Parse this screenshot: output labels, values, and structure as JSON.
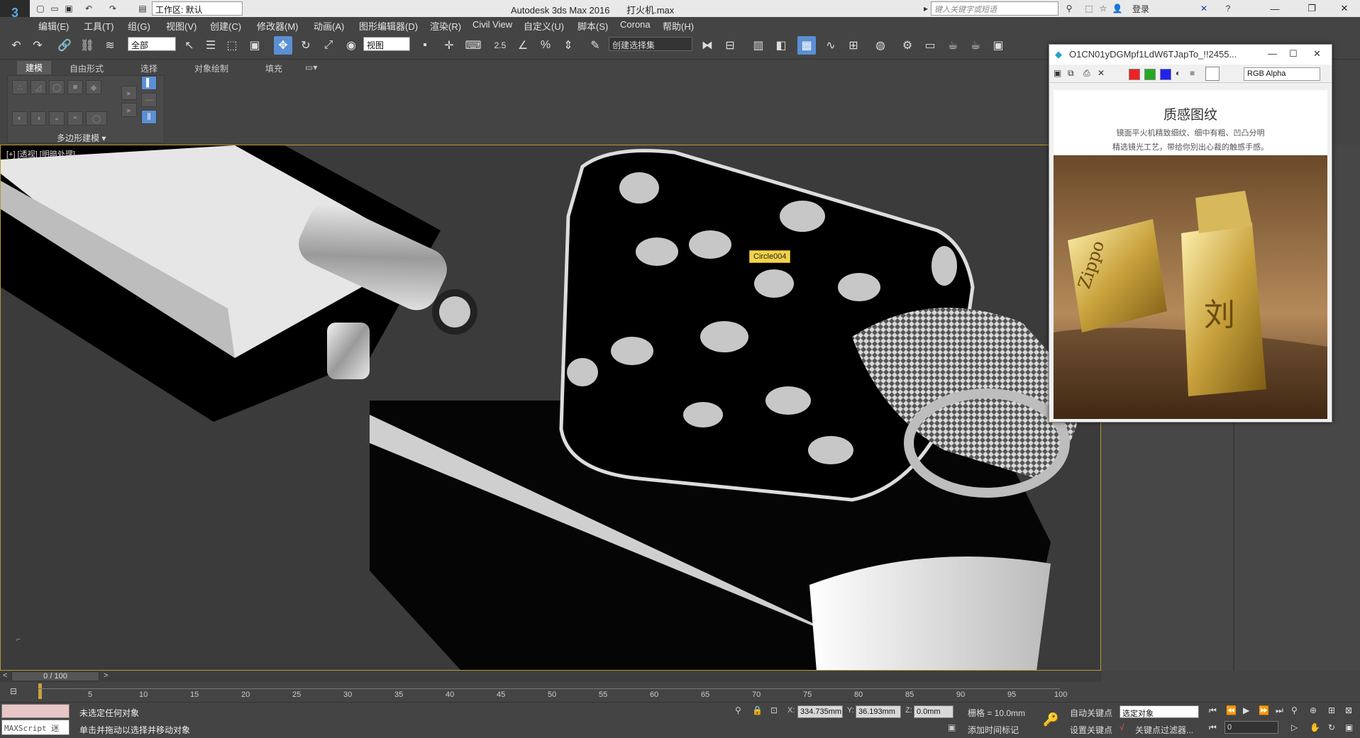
{
  "titlebar": {
    "workspace": "工作区: 默认",
    "app": "Autodesk 3ds Max 2016",
    "file": "打火机.max",
    "search_placeholder": "键入关键字或短语",
    "login": "登录"
  },
  "menu": [
    "编辑(E)",
    "工具(T)",
    "组(G)",
    "视图(V)",
    "创建(C)",
    "修改器(M)",
    "动画(A)",
    "图形编辑器(D)",
    "渲染(R)",
    "Civil View",
    "自定义(U)",
    "脚本(S)",
    "Corona",
    "帮助(H)"
  ],
  "toolbar": {
    "filter": "全部",
    "ref_coord": "视图",
    "selection_set": "创建选择集",
    "snap_value": "2.5"
  },
  "ribbon": {
    "tabs": [
      "建模",
      "自由形式",
      "选择",
      "对象绘制",
      "填充"
    ],
    "panel_label": "多边形建模"
  },
  "viewport": {
    "label": "[+] [透视] [明暗处理]",
    "object_tooltip": "Circle004"
  },
  "image_window": {
    "title": "O1CN01yDGMpf1LdW6TJapTo_!!2455...",
    "channel": "RGB Alpha",
    "render_heading": "质感图纹",
    "render_line1": "镜面平火机精致细纹、细中有粗、凹凸分明",
    "render_line2": "精选镜光工艺，带给你別出心裁的触感手感。",
    "brand": "Zippo",
    "engraving": "刘"
  },
  "timeline": {
    "frame": "0 / 100",
    "ticks": [
      "5",
      "10",
      "15",
      "20",
      "25",
      "30",
      "35",
      "40",
      "45",
      "50",
      "55",
      "60",
      "65",
      "70",
      "75",
      "80",
      "85",
      "90",
      "95",
      "100"
    ]
  },
  "status": {
    "maxscript": "MAXScript 迷",
    "selection": "未选定任何对象",
    "hint": "单击并拖动以选择并移动对象",
    "x_label": "X:",
    "x": "334.735mm",
    "y_label": "Y:",
    "y": "36.193mm",
    "z_label": "Z:",
    "z": "0.0mm",
    "grid": "栅格 = 10.0mm",
    "add_time_tag": "添加时间标记",
    "auto_key": "自动关键点",
    "set_key": "设置关键点",
    "key_mode": "选定对象",
    "key_filters": "关键点过滤器...",
    "current_frame": "0"
  },
  "colors": {
    "accent": "#5b8fd4",
    "viewport_border": "#b89a2c",
    "tooltip": "#f3d34a"
  }
}
